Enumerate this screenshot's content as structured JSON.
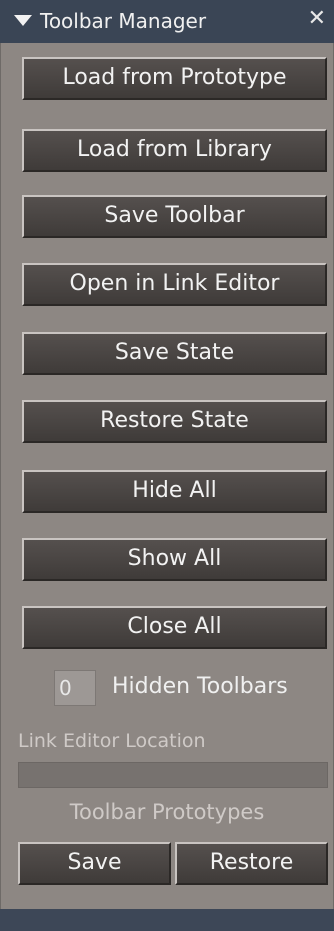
{
  "window": {
    "title": "Toolbar Manager",
    "collapse_icon": "triangle-down-icon",
    "close_icon": "close-icon"
  },
  "buttons": [
    {
      "label": "Load from Prototype"
    },
    {
      "label": "Load from Library"
    },
    {
      "label": "Save Toolbar"
    },
    {
      "label": "Open in Link Editor"
    },
    {
      "label": "Save State"
    },
    {
      "label": "Restore State"
    },
    {
      "label": "Hide All"
    },
    {
      "label": "Show All"
    },
    {
      "label": "Close All"
    }
  ],
  "hidden_toolbars": {
    "count": "0",
    "label": "Hidden Toolbars"
  },
  "link_editor": {
    "label": "Link Editor Location",
    "value": ""
  },
  "prototypes": {
    "label": "Toolbar Prototypes",
    "save_label": "Save",
    "restore_label": "Restore"
  },
  "colors": {
    "titlebar": "#3a4555",
    "panel": "#8d8783",
    "button": "#4a4543"
  }
}
